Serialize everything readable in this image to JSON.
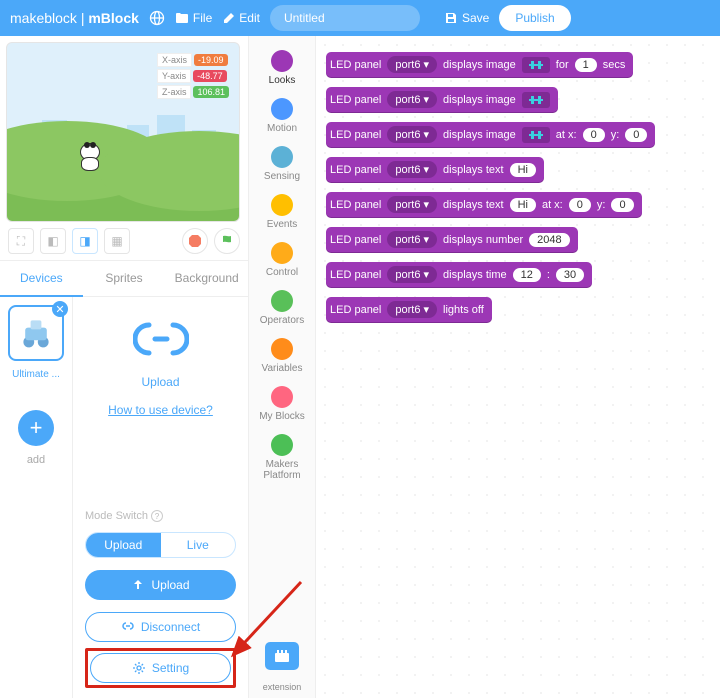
{
  "header": {
    "brand_a": "makeblock",
    "brand_b": "mBlock",
    "file": "File",
    "edit": "Edit",
    "title_placeholder": "Untitled",
    "save": "Save",
    "publish": "Publish"
  },
  "stage": {
    "axes": [
      {
        "label": "X-axis",
        "value": "-19.09",
        "color": "#f07c3e"
      },
      {
        "label": "Y-axis",
        "value": "-48.77",
        "color": "#e84a5f"
      },
      {
        "label": "Z-axis",
        "value": "106.81",
        "color": "#5cc05c"
      }
    ]
  },
  "tabs": {
    "devices": "Devices",
    "sprites": "Sprites",
    "background": "Background"
  },
  "device": {
    "thumb_name": "Ultimate ...",
    "add": "add",
    "upload_caption": "Upload",
    "howto": "How to use device?",
    "mode_switch": "Mode Switch",
    "mode_upload": "Upload",
    "mode_live": "Live",
    "btn_upload": "Upload",
    "btn_disconnect": "Disconnect",
    "btn_setting": "Setting"
  },
  "categories": [
    {
      "name": "Looks",
      "color": "#9c37b5",
      "active": true
    },
    {
      "name": "Motion",
      "color": "#4c97ff"
    },
    {
      "name": "Sensing",
      "color": "#5cb1d6"
    },
    {
      "name": "Events",
      "color": "#ffbf00"
    },
    {
      "name": "Control",
      "color": "#ffab19"
    },
    {
      "name": "Operators",
      "color": "#59c059"
    },
    {
      "name": "Variables",
      "color": "#ff8c1a"
    },
    {
      "name": "My Blocks",
      "color": "#ff6680"
    },
    {
      "name": "Makers Platform",
      "color": "#4cbf56"
    }
  ],
  "ext": "extension",
  "blocks": {
    "led": "LED panel",
    "port": "port6 ▾",
    "b0": {
      "t1": "displays image",
      "t2": "for",
      "secs": "1",
      "t3": "secs"
    },
    "b1": {
      "t1": "displays image"
    },
    "b2": {
      "t1": "displays image",
      "t2": "at x:",
      "x": "0",
      "t3": "y:",
      "y": "0"
    },
    "b3": {
      "t1": "displays text",
      "v": "Hi"
    },
    "b4": {
      "t1": "displays text",
      "v": "Hi",
      "t2": "at x:",
      "x": "0",
      "t3": "y:",
      "y": "0"
    },
    "b5": {
      "t1": "displays number",
      "v": "2048"
    },
    "b6": {
      "t1": "displays time",
      "h": "12",
      "sep": ":",
      "m": "30"
    },
    "b7": {
      "t1": "lights off"
    }
  }
}
